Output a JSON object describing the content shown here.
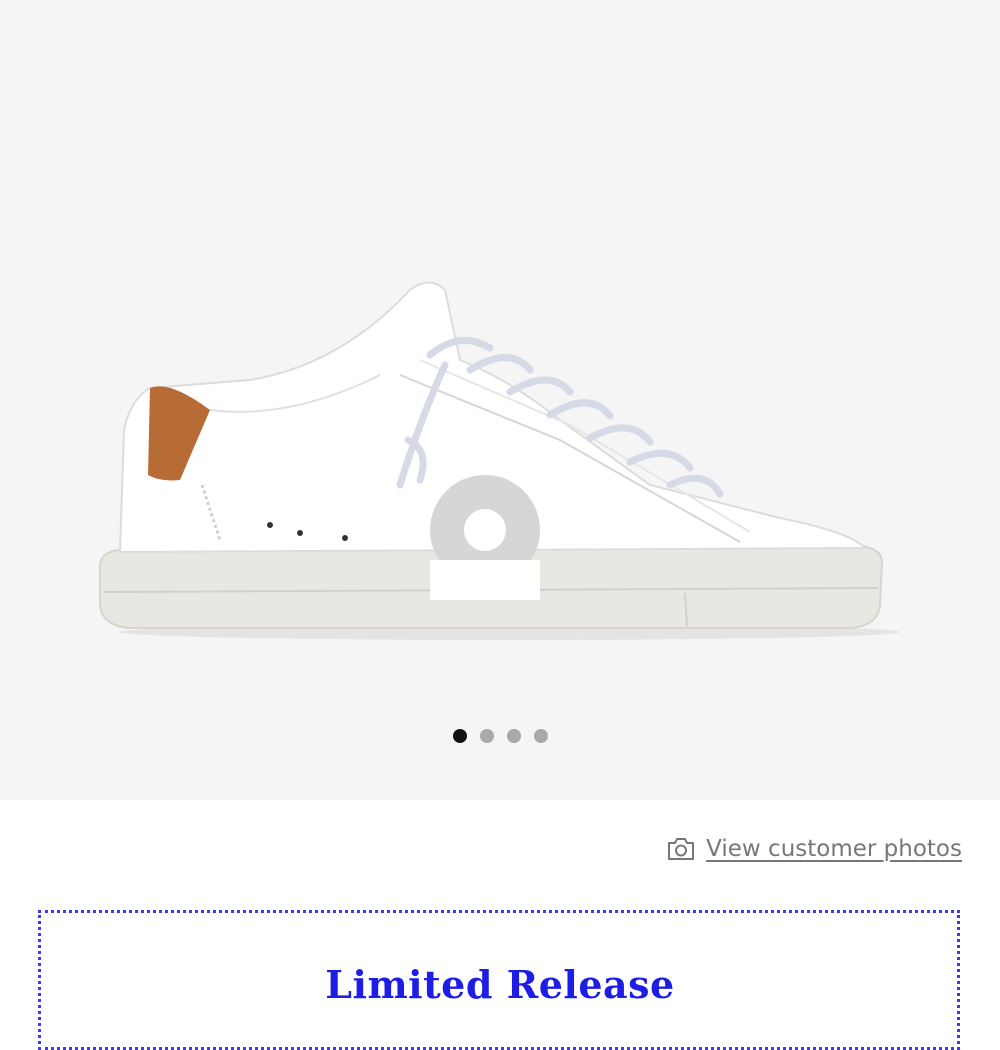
{
  "product_gallery": {
    "image_alt": "White leather low-top sneaker with tan heel tab and grey suede circle logo",
    "carousel": {
      "total": 4,
      "active_index": 0
    }
  },
  "customer_photos": {
    "link_label": "View customer photos",
    "icon": "camera-icon"
  },
  "promo": {
    "title": "Limited Release",
    "accent_color": "#1d1de6",
    "border_color": "#3a3aee"
  }
}
